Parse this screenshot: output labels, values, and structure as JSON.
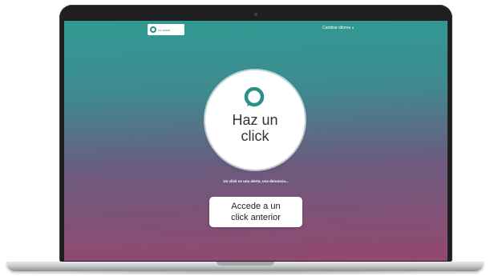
{
  "header": {
    "logo_text": "zo-reset",
    "language_label": "Cambiar idioma"
  },
  "hero": {
    "line1": "Haz un",
    "line2": "click",
    "icon": "chat-bubble-icon"
  },
  "tagline": "Un click es una alerta, una denuncia...",
  "previous_click_button": {
    "line1": "Accede a un",
    "line2": "click anterior"
  },
  "colors": {
    "gradient_top": "#2f9b93",
    "gradient_bottom": "#94486f",
    "brand": "#2c8f8a"
  }
}
